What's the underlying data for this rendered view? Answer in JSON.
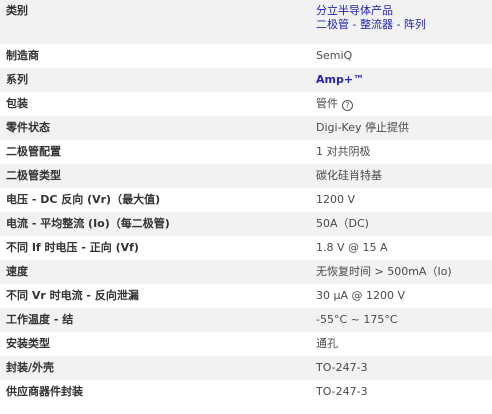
{
  "category": {
    "label": "类别",
    "line1": "分立半导体产品",
    "line2": "二极管 - 整流器 - 阵列"
  },
  "rows": [
    {
      "label": "制造商",
      "value": "SemiQ"
    },
    {
      "label": "系列",
      "value": "Amp+™"
    },
    {
      "label": "包装",
      "value": "管件"
    },
    {
      "label": "零件状态",
      "value": "Digi-Key 停止提供"
    },
    {
      "label": "二极管配置",
      "value": "1 对共阴极"
    },
    {
      "label": "二极管类型",
      "value": "碳化硅肖特基"
    },
    {
      "label": "电压 - DC 反向 (Vr)（最大值)",
      "value": "1200 V"
    },
    {
      "label": "电流 - 平均整流 (Io)（每二极管)",
      "value": "50A（DC)"
    },
    {
      "label": "不同 If 时电压 - 正向 (Vf)",
      "value": "1.8 V @ 15 A"
    },
    {
      "label": "速度",
      "value": "无恢复时间 > 500mA（Io)"
    },
    {
      "label": "不同 Vr 时电流 - 反向泄漏",
      "value": "30 µA @ 1200 V"
    },
    {
      "label": "工作温度 - 结",
      "value": "-55°C ~ 175°C"
    },
    {
      "label": "安装类型",
      "value": "通孔"
    },
    {
      "label": "封装/外壳",
      "value": "TO-247-3"
    },
    {
      "label": "供应商器件封装",
      "value": "TO-247-3"
    }
  ],
  "icons": {
    "packaging_help": "help-circle-icon"
  },
  "colors": {
    "link": "#2323b4",
    "row_alt": "#f2f2f2"
  }
}
